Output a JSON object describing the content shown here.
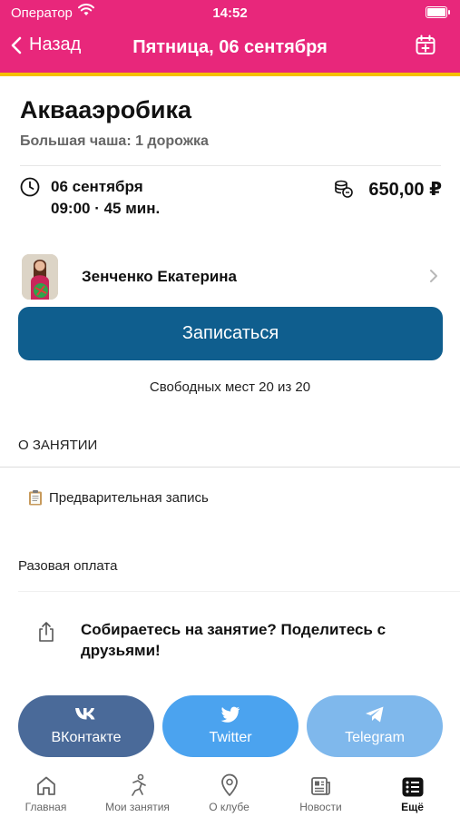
{
  "status_bar": {
    "carrier": "Оператор",
    "time": "14:52"
  },
  "nav": {
    "back_label": "Назад",
    "title": "Пятница, 06 сентября"
  },
  "event": {
    "title": "Аквааэробика",
    "location": "Большая чаша: 1 дорожка",
    "date": "06 сентября",
    "time_duration": "09:00 · 45 мин.",
    "price": "650,00 ₽"
  },
  "trainer": {
    "name": "Зенченко Екатерина"
  },
  "signup_button": "Записаться",
  "free_places": "Свободных мест 20 из 20",
  "about": {
    "heading": "О ЗАНЯТИИ",
    "prebooking": "Предварительная запись",
    "payment": "Разовая оплата"
  },
  "share": {
    "text": "Собираетесь на занятие? Поделитесь с друзьями!",
    "buttons": [
      {
        "label": "ВКонтакте",
        "icon": "vk-icon",
        "color": "#4a6a99"
      },
      {
        "label": "Twitter",
        "icon": "twitter-icon",
        "color": "#4ba3ef"
      },
      {
        "label": "Telegram",
        "icon": "telegram-icon",
        "color": "#7fb8ec"
      }
    ]
  },
  "tabs": [
    {
      "label": "Главная",
      "icon": "home-icon"
    },
    {
      "label": "Мои занятия",
      "icon": "activity-icon"
    },
    {
      "label": "О клубе",
      "icon": "location-pin-icon"
    },
    {
      "label": "Новости",
      "icon": "newspaper-icon"
    },
    {
      "label": "Ещё",
      "icon": "list-icon",
      "active": true
    }
  ],
  "colors": {
    "header": "#e8277b",
    "accent_stripe": "#f5c000",
    "primary_button": "#0f5e8e"
  }
}
